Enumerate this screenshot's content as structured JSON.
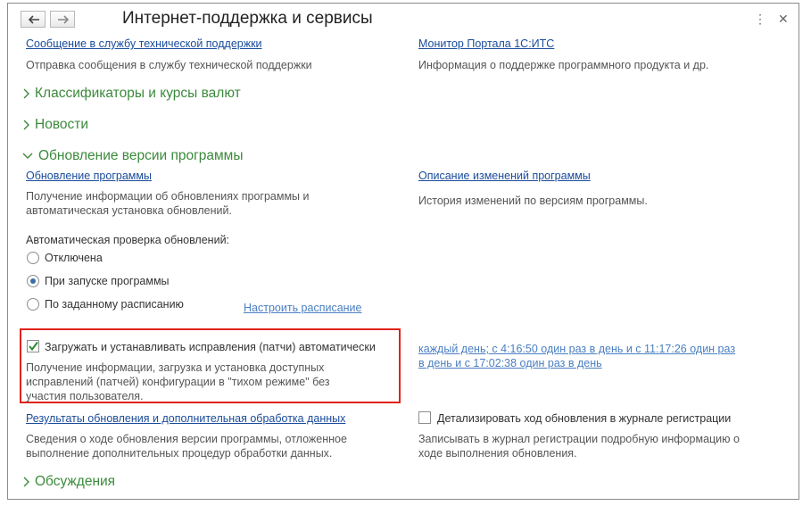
{
  "window": {
    "title": "Интернет-поддержка и сервисы",
    "back_icon": "arrow-left-icon",
    "forward_icon": "arrow-right-icon",
    "menu_icon": "more-vertical-icon",
    "close_icon": "close-icon"
  },
  "top": {
    "support_link": "Сообщение в службу технической поддержки",
    "support_desc": "Отправка сообщения в службу технической поддержки",
    "monitor_link": "Монитор Портала 1С:ИТС",
    "monitor_desc": "Информация о поддержке программного продукта и др."
  },
  "sections": {
    "classifiers": "Классификаторы и курсы валют",
    "news": "Новости",
    "update": "Обновление версии программы",
    "discussions": "Обсуждения"
  },
  "update": {
    "update_link": "Обновление программы",
    "update_desc": "Получение информации об обновлениях программы и автоматическая установка обновлений.",
    "changes_link": "Описание изменений программы",
    "changes_desc": "История изменений по версиям программы.",
    "auto_check_label": "Автоматическая проверка обновлений:",
    "radio_off": "Отключена",
    "radio_startup": "При запуске программы",
    "radio_schedule": "По заданному расписанию",
    "selected_radio": "При запуске программы",
    "schedule_link": "Настроить расписание",
    "patches_checkbox": "Загружать и устанавливать исправления (патчи) автоматически",
    "patches_checked": true,
    "patches_desc": "Получение информации, загрузка и установка доступных исправлений (патчей) конфигурации в \"тихом режиме\" без участия пользователя.",
    "patches_schedule_link": "каждый день; с 4:16:50 один раз в день и с 11:17:26 один раз в день и с 17:02:38 один раз в день",
    "results_link": "Результаты обновления и дополнительная обработка данных",
    "results_desc": "Сведения о ходе обновления версии программы, отложенное выполнение дополнительных процедур обработки данных.",
    "detail_checkbox": "Детализировать ход обновления в журнале регистрации",
    "detail_checked": false,
    "detail_desc": "Записывать в журнал регистрации подробную информацию о ходе выполнения обновления."
  },
  "colors": {
    "section_green": "#3b8a3b",
    "link_blue": "#1a4b9a",
    "highlight_red": "#e2231a"
  }
}
